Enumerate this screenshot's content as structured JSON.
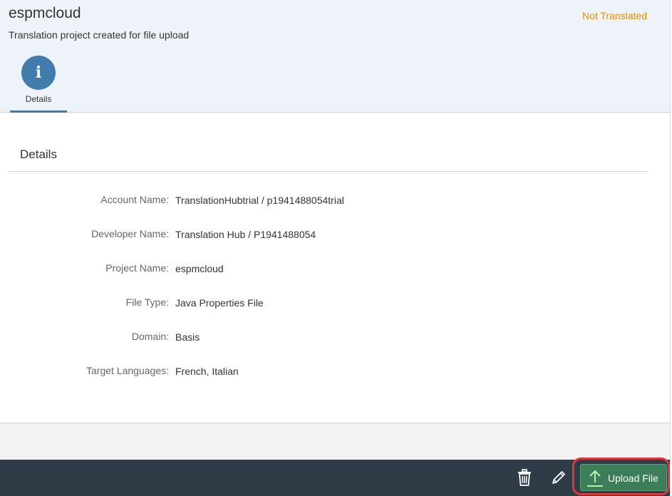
{
  "header": {
    "title": "espmcloud",
    "subtitle": "Translation project created for file upload",
    "status": "Not Translated",
    "status_color": "#e78c07",
    "tabs": [
      {
        "label": "Details",
        "icon": "info-icon",
        "selected": true
      }
    ]
  },
  "details": {
    "section_title": "Details",
    "fields": [
      {
        "label": "Account Name:",
        "value": "TranslationHubtrial / p1941488054trial"
      },
      {
        "label": "Developer Name:",
        "value": "Translation Hub / P1941488054"
      },
      {
        "label": "Project Name:",
        "value": "espmcloud"
      },
      {
        "label": "File Type:",
        "value": "Java Properties File"
      },
      {
        "label": "Domain:",
        "value": "Basis"
      },
      {
        "label": "Target Languages:",
        "value": "French, Italian"
      }
    ]
  },
  "footer": {
    "delete_icon": "trash-icon",
    "edit_icon": "pencil-icon",
    "upload_icon": "upload-icon",
    "upload_label": "Upload File",
    "accent_color": "#3c7d5a",
    "bar_color": "#2f3c48"
  }
}
